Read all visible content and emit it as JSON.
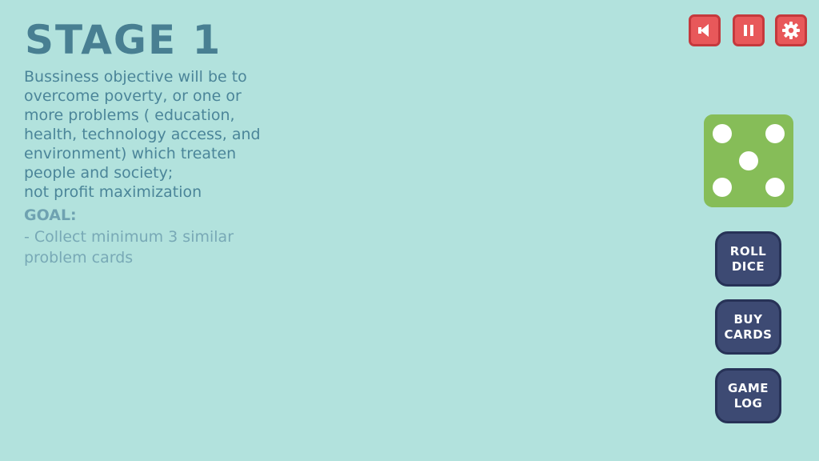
{
  "stage": {
    "title": "STAGE 1"
  },
  "objective": {
    "text": "Bussiness objective will be to\novercome poverty, or one or\nmore problems ( education,\nhealth, technology access, and\nenvironment) which treaten\npeople and society;\nnot profit maximization"
  },
  "goal": {
    "heading": "GOAL:",
    "item": "- Collect minimum 3 similar\n  problem cards"
  },
  "top_controls": {
    "sound_icon": "speaker-icon",
    "pause_icon": "pause-icon",
    "settings_icon": "gear-icon"
  },
  "dice": {
    "value": 5
  },
  "actions": {
    "roll_dice": "ROLL\nDICE",
    "buy_cards": "BUY\nCARDS",
    "game_log": "GAME\nLOG"
  },
  "colors": {
    "background": "#b2e2dd",
    "title": "#487f92",
    "control_red": "#e8585a",
    "dice_green": "#86bd58",
    "action_navy": "#3d4a73"
  }
}
